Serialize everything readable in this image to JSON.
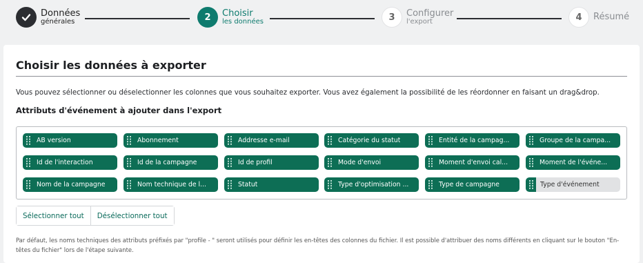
{
  "stepper": {
    "steps": [
      {
        "number": "",
        "title": "Données",
        "subtitle": "générales",
        "state": "done"
      },
      {
        "number": "2",
        "title": "Choisir",
        "subtitle": "les données",
        "state": "active"
      },
      {
        "number": "3",
        "title": "Configurer",
        "subtitle": "l'export",
        "state": "todo"
      },
      {
        "number": "4",
        "title": "Résumé",
        "subtitle": "",
        "state": "todo"
      }
    ]
  },
  "card": {
    "title": "Choisir les données à exporter",
    "description": "Vous pouvez sélectionner ou déselectionner les colonnes que vous souhaitez exporter. Vous avez également la possibilité de les réordonner en faisant un drag&drop.",
    "section_title": "Attributs d'événement à ajouter dans l'export",
    "attributes": [
      {
        "label": "AB version",
        "selected": true
      },
      {
        "label": "Abonnement",
        "selected": true
      },
      {
        "label": "Addresse e-mail",
        "selected": true
      },
      {
        "label": "Catégorie du statut",
        "selected": true
      },
      {
        "label": "Entité de la campag...",
        "selected": true
      },
      {
        "label": "Groupe de la campa...",
        "selected": true
      },
      {
        "label": "Id de l'interaction",
        "selected": true
      },
      {
        "label": "Id de la campagne",
        "selected": true
      },
      {
        "label": "Id de profil",
        "selected": true
      },
      {
        "label": "Mode d'envoi",
        "selected": true
      },
      {
        "label": "Moment d'envoi cal...",
        "selected": true
      },
      {
        "label": "Moment de l'événe...",
        "selected": true
      },
      {
        "label": "Nom de la campagne",
        "selected": true
      },
      {
        "label": "Nom technique de l...",
        "selected": true
      },
      {
        "label": "Statut",
        "selected": true
      },
      {
        "label": "Type d'optimisation ...",
        "selected": true
      },
      {
        "label": "Type de campagne",
        "selected": true
      },
      {
        "label": "Type d'événement",
        "selected": false
      }
    ],
    "select_all_label": "Sélectionner tout",
    "deselect_all_label": "Désélectionner tout",
    "footnote": "Par défaut, les noms techniques des attributs préfixés par \"profile - \" seront utilisés pour définir les en-têtes des colonnes du fichier. Il est possible d'attribuer des noms différents en cliquant sur le bouton \"En-têtes du fichier\" lors de l'étape suivante."
  },
  "icons": {
    "done_step": "check-icon",
    "chip_handle": "drag-handle-icon"
  },
  "colors": {
    "accent": "#0e7b6e",
    "chip": "#0d6e55",
    "chip_unselected": "#e1e2e4",
    "done": "#2b2d31"
  }
}
